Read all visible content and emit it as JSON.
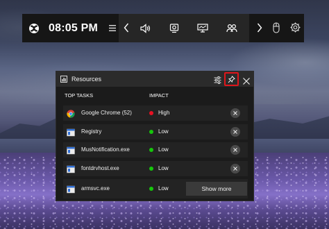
{
  "gamebar": {
    "time": "08:05 PM",
    "icons": [
      "xbox-icon",
      "menu-icon",
      "chevron-left-icon",
      "audio-icon",
      "capture-icon",
      "performance-icon",
      "social-icon",
      "chevron-right-icon",
      "mouse-icon",
      "gear-icon"
    ]
  },
  "widget": {
    "title": "Resources",
    "columns": {
      "task": "TOP TASKS",
      "impact": "IMPACT"
    },
    "show_more": "Show more",
    "colors": {
      "high": "#e81123",
      "low": "#16c60c",
      "pin_highlight": "#e0161b"
    },
    "rows": [
      {
        "name": "Google Chrome (52)",
        "impact": "High",
        "icon": "chrome-icon"
      },
      {
        "name": "Registry",
        "impact": "Low",
        "icon": "app-window-icon"
      },
      {
        "name": "MusNotification.exe",
        "impact": "Low",
        "icon": "app-window-icon"
      },
      {
        "name": "fontdrvhost.exe",
        "impact": "Low",
        "icon": "app-window-icon"
      },
      {
        "name": "armsvc.exe",
        "impact": "Low",
        "icon": "app-window-icon"
      }
    ]
  }
}
